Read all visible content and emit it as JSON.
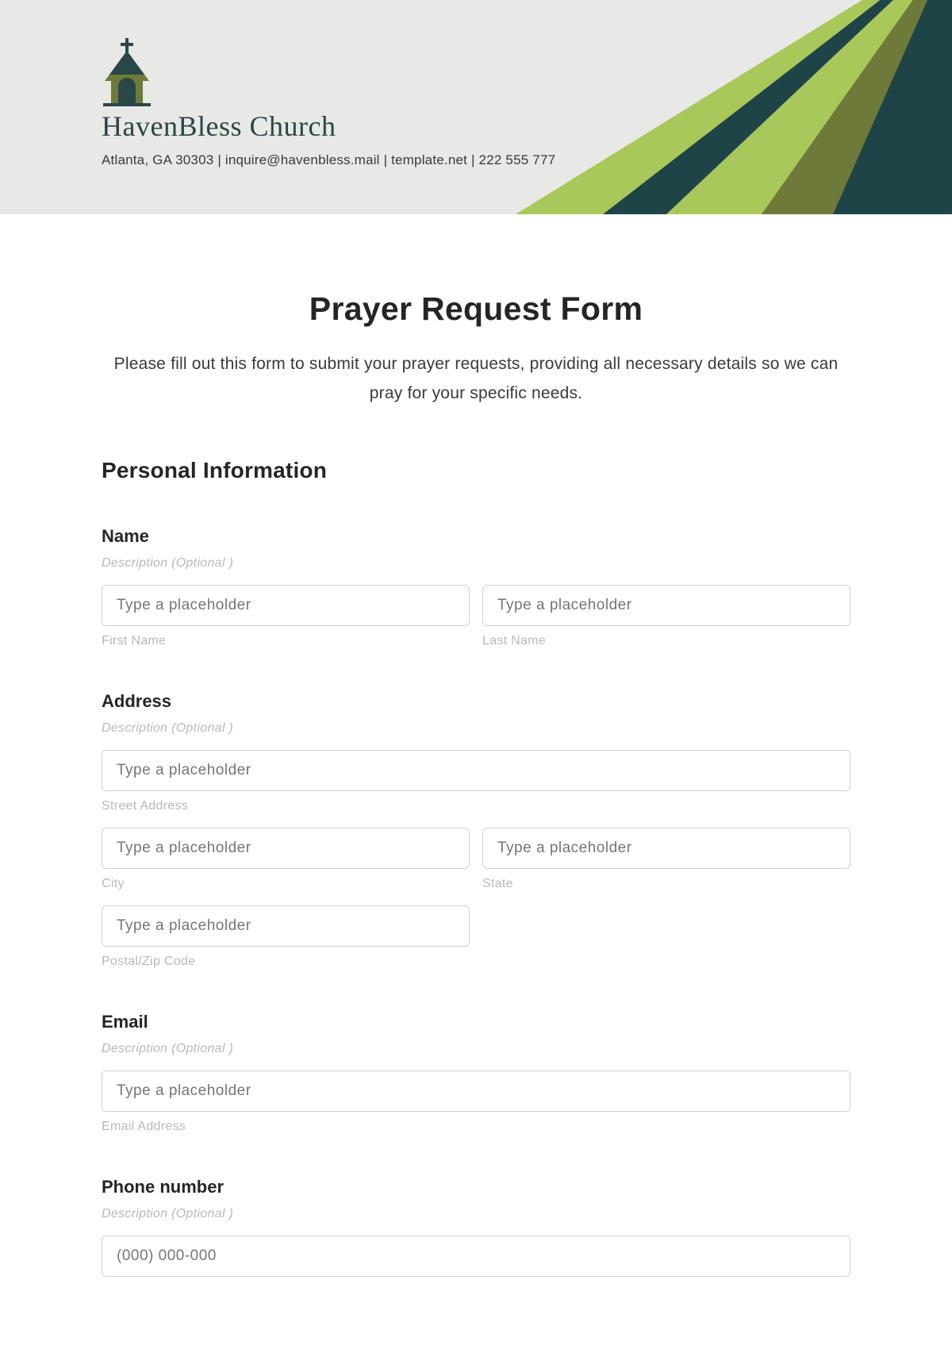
{
  "header": {
    "org_name": "HavenBless Church",
    "contact": "Atlanta, GA 30303 | inquire@havenbless.mail | template.net | 222 555 777"
  },
  "form": {
    "title": "Prayer Request Form",
    "intro": "Please fill out this form to submit your prayer requests, providing all necessary details so we can pray for your specific needs.",
    "section_personal": "Personal Information",
    "desc_optional": "Description  (Optional )",
    "placeholder_generic": "Type a placeholder",
    "name": {
      "label": "Name",
      "first_sub": "First Name",
      "last_sub": "Last Name"
    },
    "address": {
      "label": "Address",
      "street_sub": "Street Address",
      "city_sub": "City",
      "state_sub": "State",
      "zip_sub": "Postal/Zip Code"
    },
    "email": {
      "label": "Email",
      "sub": "Email Address"
    },
    "phone": {
      "label": "Phone number",
      "placeholder": "(000) 000-000"
    }
  },
  "colors": {
    "dark_teal": "#1f4447",
    "olive": "#6e7a3a",
    "lime": "#a9c85a"
  }
}
